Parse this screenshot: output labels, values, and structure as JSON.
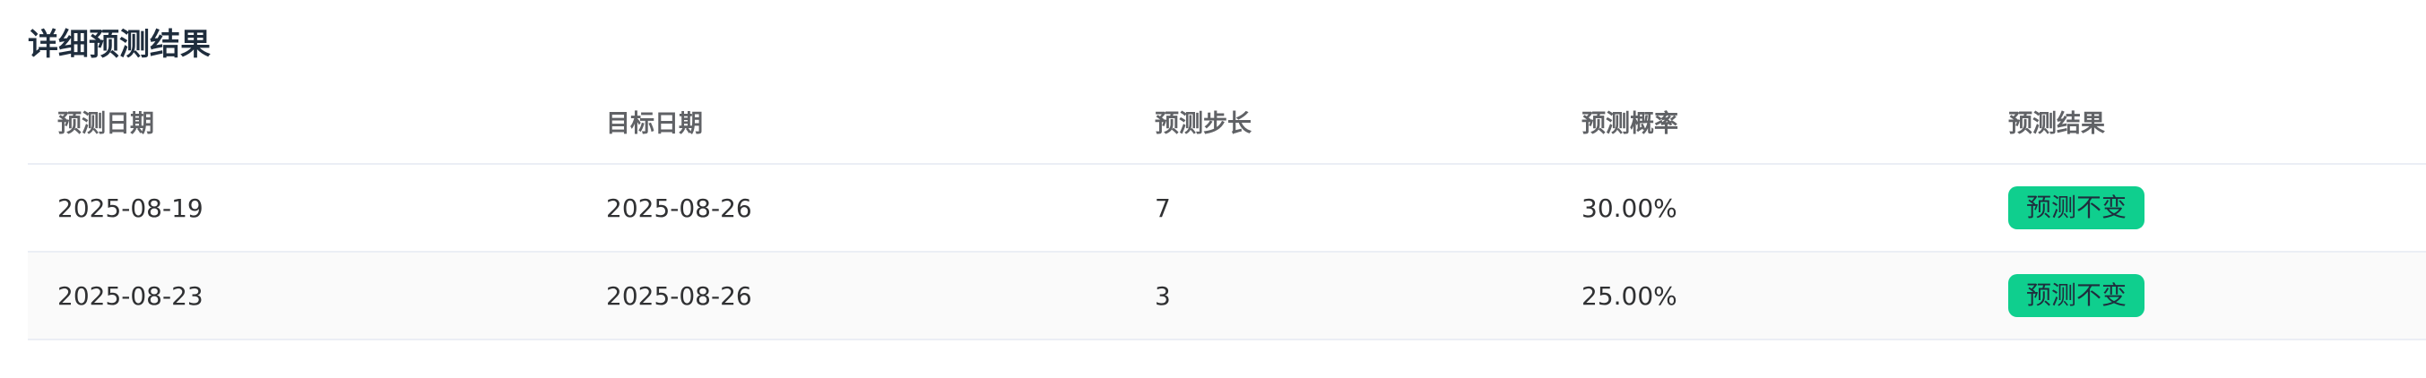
{
  "section": {
    "title": "详细预测结果"
  },
  "table": {
    "headers": [
      "预测日期",
      "目标日期",
      "预测步长",
      "预测概率",
      "预测结果"
    ],
    "rows": [
      {
        "predict_date": "2025-08-19",
        "target_date": "2025-08-26",
        "step": "7",
        "probability": "30.00%",
        "result": "预测不变"
      },
      {
        "predict_date": "2025-08-23",
        "target_date": "2025-08-26",
        "step": "3",
        "probability": "25.00%",
        "result": "预测不变"
      }
    ]
  },
  "colors": {
    "result_tag_background": "#0fcf8e",
    "title_text": "#1f2d3d",
    "header_text": "#606266",
    "row_border": "#ebeef5",
    "striped_row_background": "#fafafa"
  }
}
